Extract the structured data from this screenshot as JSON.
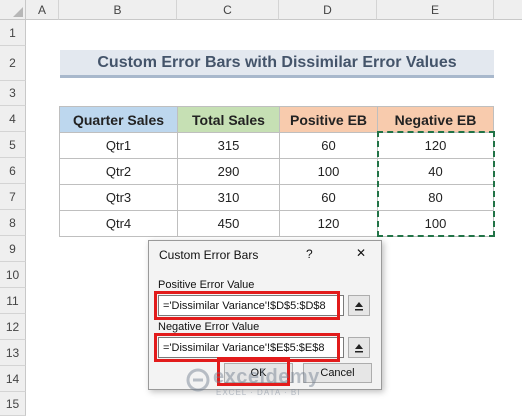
{
  "columns": [
    "A",
    "B",
    "C",
    "D",
    "E"
  ],
  "rows": [
    "1",
    "2",
    "3",
    "4",
    "5",
    "6",
    "7",
    "8",
    "9",
    "10",
    "11",
    "12",
    "13",
    "14",
    "15"
  ],
  "title": "Custom Error Bars with Dissimilar Error Values",
  "table": {
    "headers": [
      "Quarter Sales",
      "Total Sales",
      "Positive EB",
      "Negative EB"
    ],
    "header_colors": [
      "#bdd7ee",
      "#c6e0b4",
      "#f8cbad",
      "#f8cbad"
    ],
    "rows": [
      [
        "Qtr1",
        "315",
        "60",
        "120"
      ],
      [
        "Qtr2",
        "290",
        "100",
        "40"
      ],
      [
        "Qtr3",
        "310",
        "60",
        "80"
      ],
      [
        "Qtr4",
        "450",
        "120",
        "100"
      ]
    ]
  },
  "dialog": {
    "title": "Custom Error Bars",
    "help": "?",
    "close": "✕",
    "positive_label": "Positive Error Value",
    "positive_value": "='Dissimilar Variance'!$D$5:$D$8",
    "negative_label": "Negative Error Value",
    "negative_value": "='Dissimilar Variance'!$E$5:$E$8",
    "ok": "OK",
    "cancel": "Cancel"
  },
  "watermark": {
    "brand": "exceldemy",
    "tagline": "EXCEL · DATA · BI"
  }
}
